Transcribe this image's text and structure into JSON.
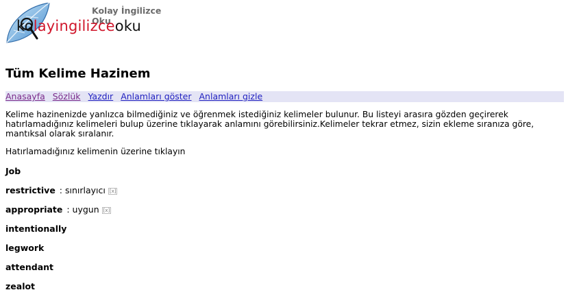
{
  "site": {
    "title": "Kolay İngilizce Oku",
    "logo_parts": [
      "k",
      "o",
      "layingilizce",
      "oku"
    ]
  },
  "page": {
    "title": "Tüm Kelime Hazinem"
  },
  "nav": [
    {
      "label": "Anasayfa",
      "visited": true
    },
    {
      "label": "Sözlük",
      "visited": true
    },
    {
      "label": "Yazdır",
      "visited": false
    },
    {
      "label": "Anlamları göster",
      "visited": false
    },
    {
      "label": "Anlamları gizle",
      "visited": false
    }
  ],
  "intro": "Kelime hazinenizde yanlızca bilmediğiniz ve öğrenmek istediğiniz kelimeler bulunur. Bu listeyi arasıra gözden geçirerek hatırlamadığınız kelimeleri bulup üzerine tıklayarak anlamını görebilirsiniz.Kelimeler tekrar etmez, sizin ekleme sıranıza göre, mantıksal olarak sıralanır.",
  "hint": "Hatırlamadığınız kelimenin üzerine tıklayın",
  "words": [
    {
      "word": "Job",
      "meaning": "",
      "separator": "",
      "remove": ""
    },
    {
      "word": "restrictive",
      "separator": " : ",
      "meaning": "sınırlayıcı",
      "remove": "[x]"
    },
    {
      "word": "appropriate",
      "separator": " : ",
      "meaning": "uygun",
      "remove": "[x]"
    },
    {
      "word": "intentionally",
      "meaning": "",
      "separator": "",
      "remove": ""
    },
    {
      "word": "legwork",
      "meaning": "",
      "separator": "",
      "remove": ""
    },
    {
      "word": "attendant",
      "meaning": "",
      "separator": "",
      "remove": ""
    },
    {
      "word": "zealot",
      "meaning": "",
      "separator": "",
      "remove": ""
    }
  ],
  "colors": {
    "nav_bg": "#e4e4f5",
    "link": "#2020c0",
    "visited": "#7a2a8a",
    "logo_red": "#d0162b"
  }
}
